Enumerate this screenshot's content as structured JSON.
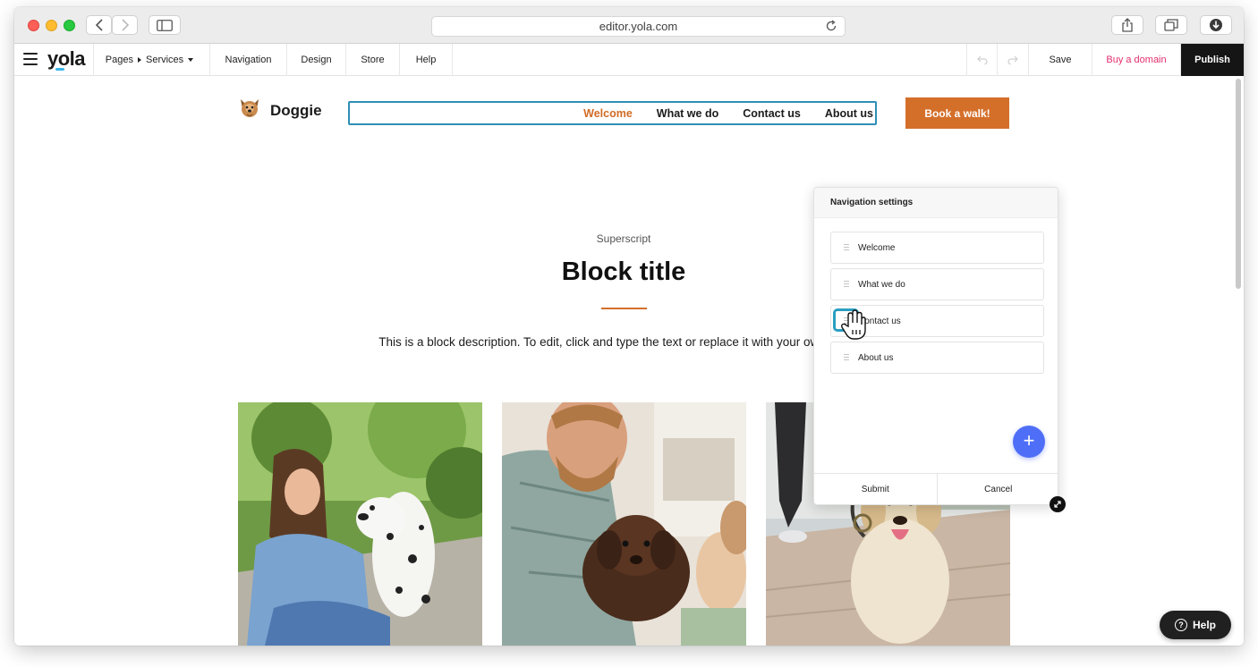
{
  "browser": {
    "url": "editor.yola.com"
  },
  "toolbar": {
    "logo": "yola",
    "pages_label": "Pages",
    "current_page": "Services",
    "navigation_label": "Navigation",
    "design_label": "Design",
    "store_label": "Store",
    "help_label": "Help",
    "save_label": "Save",
    "buy_domain_label": "Buy a domain",
    "publish_label": "Publish",
    "accent_color": "#e32f6e"
  },
  "site": {
    "name": "Doggie",
    "nav": [
      {
        "label": "Welcome",
        "active": true
      },
      {
        "label": "What we do",
        "active": false
      },
      {
        "label": "Contact us",
        "active": false
      },
      {
        "label": "About us",
        "active": false
      }
    ],
    "cta_label": "Book a walk!",
    "brand_color": "#d46f2a",
    "superscript": "Superscript",
    "block_title": "Block title",
    "block_description": "This is a block description. To edit, click and type the text or replace it with your own content",
    "photos": [
      {
        "subject": "woman-with-dalmatian"
      },
      {
        "subject": "man-with-chocolate-labrador-puppy"
      },
      {
        "subject": "golden-retriever-with-runner"
      }
    ]
  },
  "nav_panel": {
    "title": "Navigation settings",
    "items": [
      {
        "label": "Welcome"
      },
      {
        "label": "What we do"
      },
      {
        "label": "Contact us"
      },
      {
        "label": "About us"
      }
    ],
    "add_label": "+",
    "submit_label": "Submit",
    "cancel_label": "Cancel",
    "add_button_color": "#4f6ef7"
  },
  "help_widget": {
    "label": "Help"
  }
}
